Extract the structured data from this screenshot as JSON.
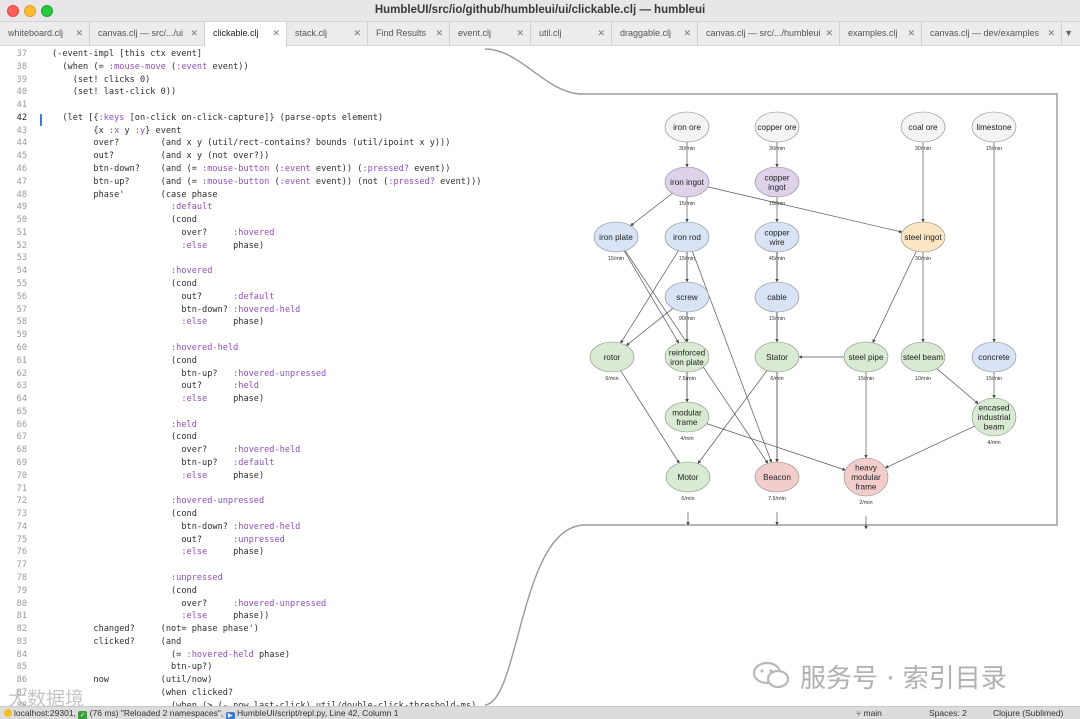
{
  "window": {
    "title": "HumbleUI/src/io/github/humbleui/ui/clickable.clj — humbleui"
  },
  "tabs": [
    {
      "label": "whiteboard.clj",
      "active": false
    },
    {
      "label": "canvas.clj — src/.../ui",
      "active": false
    },
    {
      "label": "clickable.clj",
      "active": true
    },
    {
      "label": "stack.clj",
      "active": false
    },
    {
      "label": "Find Results",
      "active": false
    },
    {
      "label": "event.clj",
      "active": false
    },
    {
      "label": "util.clj",
      "active": false
    },
    {
      "label": "draggable.clj",
      "active": false
    },
    {
      "label": "canvas.clj — src/.../humbleui",
      "active": false
    },
    {
      "label": "examples.clj",
      "active": false
    },
    {
      "label": "canvas.clj — dev/examples",
      "active": false
    }
  ],
  "tab_overflow_icon": "chevron-down-icon",
  "code": {
    "current_line": "42",
    "lines": [
      {
        "n": "37",
        "text": "(-event-impl [this ctx event]"
      },
      {
        "n": "38",
        "text": "  (when (= :mouse-move (:event event))"
      },
      {
        "n": "39",
        "text": "    (set! clicks 0)"
      },
      {
        "n": "40",
        "text": "    (set! last-click 0))"
      },
      {
        "n": "41",
        "text": ""
      },
      {
        "n": "42",
        "text": "  (let [{:keys [on-click on-click-capture]} (parse-opts element)"
      },
      {
        "n": "43",
        "text": "        {x :x y :y} event"
      },
      {
        "n": "44",
        "text": "        over?        (and x y (util/rect-contains? bounds (util/ipoint x y)))"
      },
      {
        "n": "45",
        "text": "        out?         (and x y (not over?))"
      },
      {
        "n": "46",
        "text": "        btn-down?    (and (= :mouse-button (:event event)) (:pressed? event))"
      },
      {
        "n": "47",
        "text": "        btn-up?      (and (= :mouse-button (:event event)) (not (:pressed? event)))"
      },
      {
        "n": "48",
        "text": "        phase'       (case phase"
      },
      {
        "n": "49",
        "text": "                       :default"
      },
      {
        "n": "50",
        "text": "                       (cond"
      },
      {
        "n": "51",
        "text": "                         over?     :hovered"
      },
      {
        "n": "52",
        "text": "                         :else     phase)"
      },
      {
        "n": "53",
        "text": ""
      },
      {
        "n": "54",
        "text": "                       :hovered"
      },
      {
        "n": "55",
        "text": "                       (cond"
      },
      {
        "n": "56",
        "text": "                         out?      :default"
      },
      {
        "n": "57",
        "text": "                         btn-down? :hovered-held"
      },
      {
        "n": "58",
        "text": "                         :else     phase)"
      },
      {
        "n": "59",
        "text": ""
      },
      {
        "n": "60",
        "text": "                       :hovered-held"
      },
      {
        "n": "61",
        "text": "                       (cond"
      },
      {
        "n": "62",
        "text": "                         btn-up?   :hovered-unpressed"
      },
      {
        "n": "63",
        "text": "                         out?      :held"
      },
      {
        "n": "64",
        "text": "                         :else     phase)"
      },
      {
        "n": "65",
        "text": ""
      },
      {
        "n": "66",
        "text": "                       :held"
      },
      {
        "n": "67",
        "text": "                       (cond"
      },
      {
        "n": "68",
        "text": "                         over?     :hovered-held"
      },
      {
        "n": "69",
        "text": "                         btn-up?   :default"
      },
      {
        "n": "70",
        "text": "                         :else     phase)"
      },
      {
        "n": "71",
        "text": ""
      },
      {
        "n": "72",
        "text": "                       :hovered-unpressed"
      },
      {
        "n": "73",
        "text": "                       (cond"
      },
      {
        "n": "74",
        "text": "                         btn-down? :hovered-held"
      },
      {
        "n": "75",
        "text": "                         out?      :unpressed"
      },
      {
        "n": "76",
        "text": "                         :else     phase)"
      },
      {
        "n": "77",
        "text": ""
      },
      {
        "n": "78",
        "text": "                       :unpressed"
      },
      {
        "n": "79",
        "text": "                       (cond"
      },
      {
        "n": "80",
        "text": "                         over?     :hovered-unpressed"
      },
      {
        "n": "81",
        "text": "                         :else     phase))"
      },
      {
        "n": "82",
        "text": "        changed?     (not= phase phase')"
      },
      {
        "n": "83",
        "text": "        clicked?     (and"
      },
      {
        "n": "84",
        "text": "                       (= :hovered-held phase)"
      },
      {
        "n": "85",
        "text": "                       btn-up?)"
      },
      {
        "n": "86",
        "text": "        now          (util/now)"
      },
      {
        "n": "87",
        "text": "                     (when clicked?"
      },
      {
        "n": "88",
        "text": "                       (when (> (- now last-click) util/double-click-threshold-ms)"
      }
    ]
  },
  "diagram": {
    "nodes": [
      {
        "id": "iron_ore",
        "label": [
          "iron ore"
        ],
        "color": "#f4f4f4",
        "rate": "30/min"
      },
      {
        "id": "copper_ore",
        "label": [
          "copper ore"
        ],
        "color": "#f4f4f4",
        "rate": "30/min"
      },
      {
        "id": "coal_ore",
        "label": [
          "coal ore"
        ],
        "color": "#f4f4f4",
        "rate": "30/min"
      },
      {
        "id": "limestone",
        "label": [
          "limestone"
        ],
        "color": "#f4f4f4",
        "rate": "15/min"
      },
      {
        "id": "iron_ingot",
        "label": [
          "iron ingot"
        ],
        "color": "#ddd2ea",
        "rate": "15/min"
      },
      {
        "id": "copper_ingot",
        "label": [
          "copper",
          "ingot"
        ],
        "color": "#ddd2ea",
        "rate": "15/min"
      },
      {
        "id": "iron_plate",
        "label": [
          "iron plate"
        ],
        "color": "#d8e4f6",
        "rate": "15/min"
      },
      {
        "id": "iron_rod",
        "label": [
          "iron rod"
        ],
        "color": "#d8e4f6",
        "rate": "15/min"
      },
      {
        "id": "copper_wire",
        "label": [
          "copper",
          "wire"
        ],
        "color": "#d8e4f6",
        "rate": "45/min"
      },
      {
        "id": "steel_ingot",
        "label": [
          "steel ingot"
        ],
        "color": "#fbe6c4",
        "rate": "30/min"
      },
      {
        "id": "screw",
        "label": [
          "screw"
        ],
        "color": "#d8e4f6",
        "rate": "90/min"
      },
      {
        "id": "cable",
        "label": [
          "cable"
        ],
        "color": "#d8e4f6",
        "rate": "15/min"
      },
      {
        "id": "rotor",
        "label": [
          "rotor"
        ],
        "color": "#d9ead2",
        "rate": "6/min"
      },
      {
        "id": "reinforced_iron_plate",
        "label": [
          "reinforced",
          "iron plate"
        ],
        "color": "#d9ead2",
        "rate": "7.5/min"
      },
      {
        "id": "stator",
        "label": [
          "Stator"
        ],
        "color": "#d9ead2",
        "rate": "6/min"
      },
      {
        "id": "steel_pipe",
        "label": [
          "steel pipe"
        ],
        "color": "#d9ead2",
        "rate": "15/min"
      },
      {
        "id": "steel_beam",
        "label": [
          "steel beam"
        ],
        "color": "#d9ead2",
        "rate": "10/min"
      },
      {
        "id": "concrete",
        "label": [
          "concrete"
        ],
        "color": "#d8e4f6",
        "rate": "15/min"
      },
      {
        "id": "modular_frame",
        "label": [
          "modular",
          "frame"
        ],
        "color": "#d9ead2",
        "rate": "4/min"
      },
      {
        "id": "encased_industrial_beam",
        "label": [
          "encased",
          "industrial",
          "beam"
        ],
        "color": "#d9ead2",
        "rate": "4/min"
      },
      {
        "id": "motor",
        "label": [
          "Motor"
        ],
        "color": "#d9ead2",
        "rate": "6/min"
      },
      {
        "id": "beacon",
        "label": [
          "Beacon"
        ],
        "color": "#f3cccc",
        "rate": "7.5/min"
      },
      {
        "id": "heavy_modular_frame",
        "label": [
          "heavy",
          "modular",
          "frame"
        ],
        "color": "#f3cccc",
        "rate": "2/min"
      }
    ],
    "edges": [
      [
        "iron_ore",
        "iron_ingot"
      ],
      [
        "copper_ore",
        "copper_ingot"
      ],
      [
        "coal_ore",
        "steel_ingot"
      ],
      [
        "limestone",
        "concrete"
      ],
      [
        "iron_ingot",
        "iron_plate"
      ],
      [
        "iron_ingot",
        "iron_rod"
      ],
      [
        "iron_ingot",
        "steel_ingot"
      ],
      [
        "copper_ingot",
        "copper_wire"
      ],
      [
        "iron_rod",
        "screw"
      ],
      [
        "iron_plate",
        "reinforced_iron_plate"
      ],
      [
        "iron_plate",
        "beacon"
      ],
      [
        "iron_rod",
        "rotor"
      ],
      [
        "iron_rod",
        "modular_frame"
      ],
      [
        "iron_rod",
        "beacon"
      ],
      [
        "screw",
        "rotor"
      ],
      [
        "screw",
        "reinforced_iron_plate"
      ],
      [
        "copper_wire",
        "cable"
      ],
      [
        "copper_wire",
        "stator"
      ],
      [
        "copper_wire",
        "beacon"
      ],
      [
        "cable",
        "beacon"
      ],
      [
        "steel_ingot",
        "steel_pipe"
      ],
      [
        "steel_ingot",
        "steel_beam"
      ],
      [
        "steel_pipe",
        "stator"
      ],
      [
        "steel_pipe",
        "heavy_modular_frame"
      ],
      [
        "steel_beam",
        "encased_industrial_beam"
      ],
      [
        "concrete",
        "encased_industrial_beam"
      ],
      [
        "reinforced_iron_plate",
        "modular_frame"
      ],
      [
        "rotor",
        "motor"
      ],
      [
        "stator",
        "motor"
      ],
      [
        "modular_frame",
        "heavy_modular_frame"
      ],
      [
        "encased_industrial_beam",
        "heavy_modular_frame"
      ]
    ],
    "outputs": [
      "motor",
      "beacon",
      "heavy_modular_frame"
    ]
  },
  "statusbar": {
    "host": "localhost:29301,",
    "timing": "(76 ms)",
    "message": "\"Reloaded 2 namespaces\",",
    "script": "HumbleUI/script/repl.py, Line 42, Column 1",
    "branch_icon": "git-branch-icon",
    "branch": "main",
    "spaces": "Spaces: 2",
    "syntax": "Clojure (Sublimed)"
  },
  "watermark": {
    "right_text": "服务号 · 索引目录",
    "left_text": "大数据境",
    "icon": "wechat-logo-icon"
  }
}
